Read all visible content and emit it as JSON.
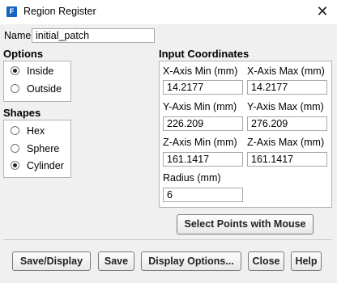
{
  "window": {
    "title": "Region Register",
    "app_icon": "F"
  },
  "name_field": {
    "label": "Name",
    "value": "initial_patch"
  },
  "options": {
    "title": "Options",
    "items": [
      {
        "label": "Inside",
        "selected": true
      },
      {
        "label": "Outside",
        "selected": false
      }
    ]
  },
  "shapes": {
    "title": "Shapes",
    "items": [
      {
        "label": "Hex",
        "selected": false
      },
      {
        "label": "Sphere",
        "selected": false
      },
      {
        "label": "Cylinder",
        "selected": true
      }
    ]
  },
  "coords": {
    "title": "Input Coordinates",
    "x_min_label": "X-Axis Min (mm)",
    "x_min": "14.2177",
    "x_max_label": "X-Axis Max (mm)",
    "x_max": "14.2177",
    "y_min_label": "Y-Axis Min (mm)",
    "y_min": "226.209",
    "y_max_label": "Y-Axis Max (mm)",
    "y_max": "276.209",
    "z_min_label": "Z-Axis Min (mm)",
    "z_min": "161.1417",
    "z_max_label": "Z-Axis Max (mm)",
    "z_max": "161.1417",
    "radius_label": "Radius (mm)",
    "radius": "6"
  },
  "buttons": {
    "select_points": "Select Points with Mouse",
    "save_display": "Save/Display",
    "save": "Save",
    "display_options": "Display Options...",
    "close": "Close",
    "help": "Help"
  },
  "icons": {
    "app": "fluent-app-icon",
    "close": "close-icon"
  }
}
